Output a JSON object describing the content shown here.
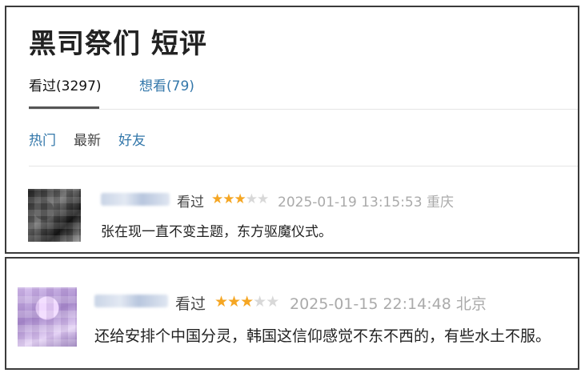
{
  "page": {
    "title": "黑司祭们 短评"
  },
  "tabs": [
    {
      "label": "看过(3297)",
      "active": true
    },
    {
      "label": "想看(79)",
      "active": false
    }
  ],
  "sort": {
    "hot": "热门",
    "new": "最新",
    "friends": "好友"
  },
  "comments": [
    {
      "status": "看过",
      "rating_stars": 3,
      "rating_max": 5,
      "time": "2025-01-19 13:15:53",
      "location": "重庆",
      "text": "张在现一直不变主题，东方驱魔仪式。"
    },
    {
      "status": "看过",
      "rating_stars": 3,
      "rating_max": 5,
      "time": "2025-01-15 22:14:48",
      "location": "北京",
      "text": "还给安排个中国分灵，韩国这信仰感觉不东不西的，有些水土不服。"
    }
  ],
  "colors": {
    "link": "#3377aa",
    "star": "#f5a623",
    "star_empty": "#d8d8d8",
    "meta": "#aaaaaa"
  }
}
